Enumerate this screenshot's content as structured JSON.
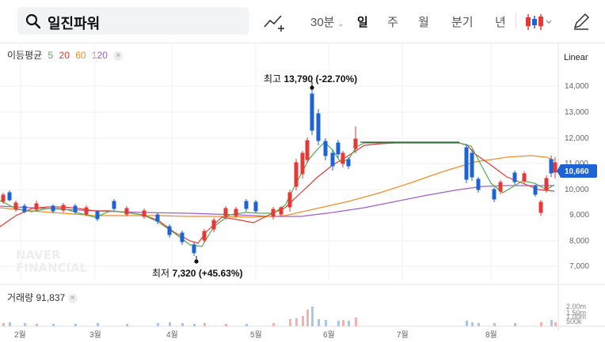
{
  "search": {
    "query": "일진파워"
  },
  "toolbar": {
    "interval": "30분",
    "periods": [
      "일",
      "주",
      "월",
      "분기",
      "년"
    ],
    "active_period": "일"
  },
  "legend": {
    "title": "이동평균",
    "ma": [
      {
        "label": "5",
        "color": "#4caf50"
      },
      {
        "label": "20",
        "color": "#e53935"
      },
      {
        "label": "60",
        "color": "#f28c28"
      },
      {
        "label": "120",
        "color": "#a05fc8"
      }
    ]
  },
  "scale_mode": "Linear",
  "annotations": {
    "high": {
      "prefix": "최고",
      "value": "13,790",
      "change": "(-22.70%)"
    },
    "low": {
      "prefix": "최저",
      "value": "7,320",
      "change": "(+45.63%)"
    }
  },
  "current_price": "10,660",
  "watermark": [
    "NAVER",
    "FINANCIAL"
  ],
  "volume": {
    "label": "거래량",
    "value": "91,837"
  },
  "price_axis": [
    "14,000",
    "13,000",
    "12,000",
    "11,000",
    "10,000",
    "9,000",
    "8,000",
    "7,000"
  ],
  "volume_axis": [
    "2.00m",
    "1.50m",
    "1.00m",
    "500k"
  ],
  "month_axis": [
    "2월",
    "3월",
    "4월",
    "5월",
    "6월",
    "7월",
    "8월"
  ],
  "colors": {
    "up": "#e53935",
    "down": "#1e63d6",
    "accent": "#1e63d6"
  }
}
